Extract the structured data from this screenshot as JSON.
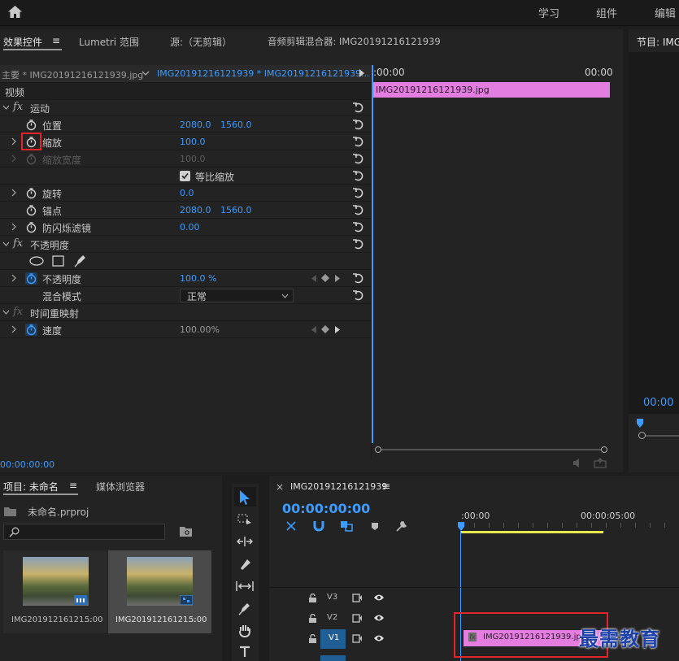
{
  "top_nav": {
    "items": [
      "学习",
      "组件",
      "编辑"
    ]
  },
  "effects_panel": {
    "tabs": [
      "效果控件",
      "Lumetri 范围",
      "源:（无剪辑）",
      "音频剪辑混合器: IMG20191216121939"
    ],
    "menu_glyph": "≡",
    "master_label": "主要 * IMG20191216121939.jpg",
    "sequence_label": "IMG20191216121939 * IMG20191216121939...",
    "section_video": "视频",
    "fx_glyph": "fx",
    "motion": "运动",
    "position_label": "位置",
    "position_x": "2080.0",
    "position_y": "1560.0",
    "scale_label": "缩放",
    "scale_value": "100.0",
    "scale_width_label": "缩放宽度",
    "scale_width_value": "100.0",
    "uniform_scale": "等比缩放",
    "rotation_label": "旋转",
    "rotation_value": "0.0",
    "anchor_label": "锚点",
    "anchor_x": "2080.0",
    "anchor_y": "1560.0",
    "flicker_label": "防闪烁滤镜",
    "flicker_value": "0.00",
    "opacity_section": "不透明度",
    "opacity_label": "不透明度",
    "opacity_value": "100.0 %",
    "blend_label": "混合模式",
    "blend_value": "正常",
    "time_remap": "时间重映射",
    "speed_label": "速度",
    "speed_value": "100.00%",
    "timecode": "00:00:00:00"
  },
  "mini_timeline": {
    "start": ":00:00",
    "end": "00:00",
    "clip_name": "IMG20191216121939.jpg"
  },
  "program_monitor": {
    "title": "节目: IMG",
    "timecode": "00:00"
  },
  "project_panel": {
    "tabs": [
      "项目: 未命名",
      "媒体浏览器"
    ],
    "menu_glyph": "≡",
    "project_file": "未命名.prproj",
    "search_placeholder": "",
    "items": [
      {
        "name": "IMG20191216121...",
        "duration": "5:00"
      },
      {
        "name": "IMG20191216121...",
        "duration": "5:00"
      }
    ]
  },
  "timeline": {
    "close_glyph": "×",
    "sequence_name": "IMG20191216121939",
    "menu_glyph": "≡",
    "timecode": "00:00:00:00",
    "ruler_start": ":00:00",
    "ruler_mid": "00:00:05:00",
    "tracks": [
      "V3",
      "V2",
      "V1"
    ],
    "clip_name": "IMG20191216121939.jpg",
    "clip_fx": "fx"
  },
  "watermark": "最需教育",
  "colors": {
    "accent": "#3d9cff",
    "clip_pink": "#e37ee0",
    "highlight_red": "#e0252b",
    "panel_bg": "#232323",
    "yellow_bar": "#e8e84a"
  }
}
